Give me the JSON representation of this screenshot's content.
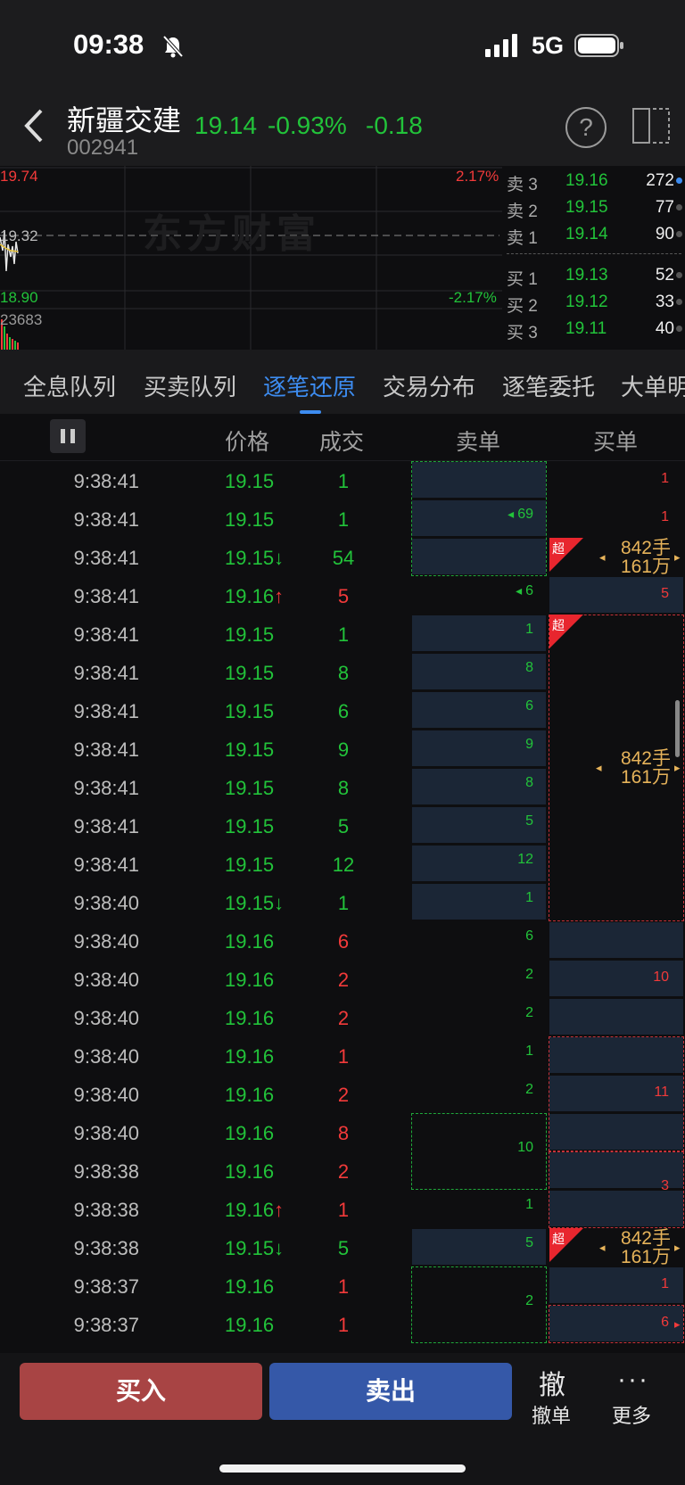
{
  "status": {
    "time": "09:38",
    "network": "5G"
  },
  "header": {
    "name": "新疆交建",
    "code": "002941",
    "price": "19.14",
    "pct": "-0.93%",
    "change": "-0.18"
  },
  "chart": {
    "high": "19.74",
    "mid": "19.32",
    "low": "18.90",
    "high_pct": "2.17%",
    "low_pct": "-2.17%",
    "volume": "23683",
    "watermark": "东方财富"
  },
  "orderbook": {
    "asks": [
      {
        "label": "卖 3",
        "price": "19.16",
        "vol": "272"
      },
      {
        "label": "卖 2",
        "price": "19.15",
        "vol": "77"
      },
      {
        "label": "卖 1",
        "price": "19.14",
        "vol": "90"
      }
    ],
    "bids": [
      {
        "label": "买 1",
        "price": "19.13",
        "vol": "52"
      },
      {
        "label": "买 2",
        "price": "19.12",
        "vol": "33"
      },
      {
        "label": "买 3",
        "price": "19.11",
        "vol": "40"
      }
    ]
  },
  "tabs": [
    "全息队列",
    "买卖队列",
    "逐笔还原",
    "交易分布",
    "逐笔委托",
    "大单明"
  ],
  "active_tab": "逐笔还原",
  "columns": {
    "price": "价格",
    "volume": "成交",
    "sell": "卖单",
    "buy": "买单"
  },
  "trades": [
    {
      "time": "9:38:41",
      "price": "19.15",
      "arrow": "",
      "vol": "1",
      "volcolor": "green"
    },
    {
      "time": "9:38:41",
      "price": "19.15",
      "arrow": "",
      "vol": "1",
      "volcolor": "green"
    },
    {
      "time": "9:38:41",
      "price": "19.15",
      "arrow": "↓",
      "vol": "54",
      "volcolor": "green"
    },
    {
      "time": "9:38:41",
      "price": "19.16",
      "arrow": "↑",
      "vol": "5",
      "volcolor": "red"
    },
    {
      "time": "9:38:41",
      "price": "19.15",
      "arrow": "",
      "vol": "1",
      "volcolor": "green"
    },
    {
      "time": "9:38:41",
      "price": "19.15",
      "arrow": "",
      "vol": "8",
      "volcolor": "green"
    },
    {
      "time": "9:38:41",
      "price": "19.15",
      "arrow": "",
      "vol": "6",
      "volcolor": "green"
    },
    {
      "time": "9:38:41",
      "price": "19.15",
      "arrow": "",
      "vol": "9",
      "volcolor": "green"
    },
    {
      "time": "9:38:41",
      "price": "19.15",
      "arrow": "",
      "vol": "8",
      "volcolor": "green"
    },
    {
      "time": "9:38:41",
      "price": "19.15",
      "arrow": "",
      "vol": "5",
      "volcolor": "green"
    },
    {
      "time": "9:38:41",
      "price": "19.15",
      "arrow": "",
      "vol": "12",
      "volcolor": "green"
    },
    {
      "time": "9:38:40",
      "price": "19.15",
      "arrow": "↓",
      "vol": "1",
      "volcolor": "green"
    },
    {
      "time": "9:38:40",
      "price": "19.16",
      "arrow": "",
      "vol": "6",
      "volcolor": "red"
    },
    {
      "time": "9:38:40",
      "price": "19.16",
      "arrow": "",
      "vol": "2",
      "volcolor": "red"
    },
    {
      "time": "9:38:40",
      "price": "19.16",
      "arrow": "",
      "vol": "2",
      "volcolor": "red"
    },
    {
      "time": "9:38:40",
      "price": "19.16",
      "arrow": "",
      "vol": "1",
      "volcolor": "red"
    },
    {
      "time": "9:38:40",
      "price": "19.16",
      "arrow": "",
      "vol": "2",
      "volcolor": "red"
    },
    {
      "time": "9:38:40",
      "price": "19.16",
      "arrow": "",
      "vol": "8",
      "volcolor": "red"
    },
    {
      "time": "9:38:38",
      "price": "19.16",
      "arrow": "",
      "vol": "2",
      "volcolor": "red"
    },
    {
      "time": "9:38:38",
      "price": "19.16",
      "arrow": "↑",
      "vol": "1",
      "volcolor": "red"
    },
    {
      "time": "9:38:38",
      "price": "19.15",
      "arrow": "↓",
      "vol": "5",
      "volcolor": "green"
    },
    {
      "time": "9:38:37",
      "price": "19.16",
      "arrow": "",
      "vol": "1",
      "volcolor": "red"
    },
    {
      "time": "9:38:37",
      "price": "19.16",
      "arrow": "",
      "vol": "1",
      "volcolor": "red"
    }
  ],
  "sell_orders": [
    "69",
    "6",
    "1",
    "8",
    "6",
    "9",
    "8",
    "5",
    "12",
    "1",
    "6",
    "2",
    "2",
    "1",
    "2",
    "10",
    "1",
    "5",
    "2"
  ],
  "buy_orders": [
    "1",
    "1",
    "5",
    "10",
    "11",
    "3",
    "1",
    "6"
  ],
  "big_orders": [
    {
      "lots": "842手",
      "amount": "161万",
      "super": "超"
    },
    {
      "lots": "842手",
      "amount": "161万",
      "super": "超"
    },
    {
      "lots": "842手",
      "amount": "161万",
      "super": "超"
    }
  ],
  "actions": {
    "buy": "买入",
    "sell": "卖出",
    "cancel_icon": "撤",
    "cancel": "撤单",
    "more_icon": "···",
    "more": "更多"
  }
}
